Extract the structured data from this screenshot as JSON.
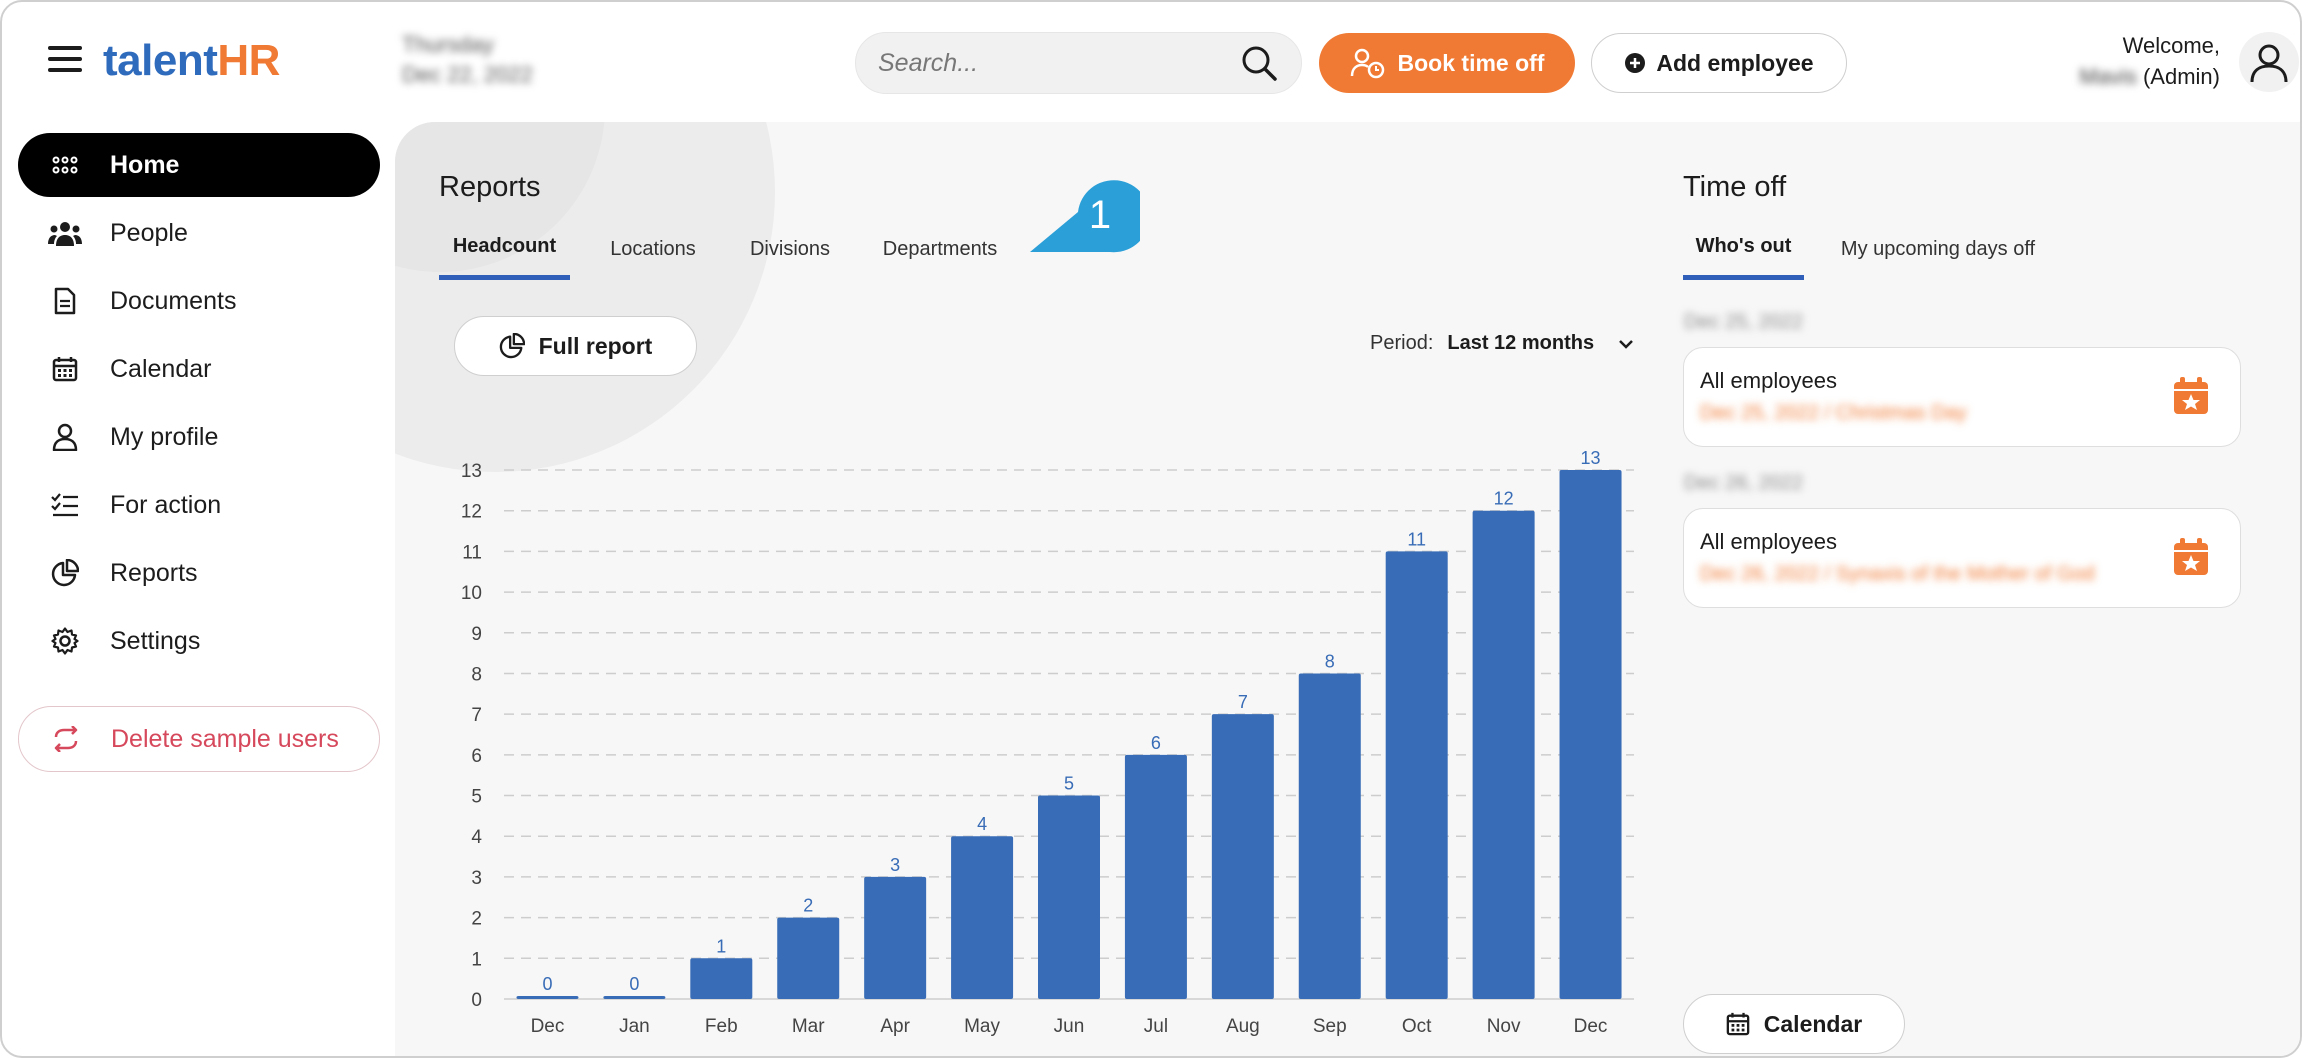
{
  "header": {
    "logo_part1": "talent",
    "logo_part2": "HR",
    "day": "Thursday",
    "date": "Dec 22, 2022",
    "search_placeholder": "Search...",
    "book_time_off": "Book time off",
    "add_employee": "Add employee",
    "welcome": "Welcome,",
    "user_name": "Mavis",
    "user_role": "(Admin)"
  },
  "sidebar": {
    "items": [
      {
        "label": "Home",
        "icon": "grid-icon"
      },
      {
        "label": "People",
        "icon": "people-icon"
      },
      {
        "label": "Documents",
        "icon": "document-icon"
      },
      {
        "label": "Calendar",
        "icon": "calendar-icon"
      },
      {
        "label": "My profile",
        "icon": "user-icon"
      },
      {
        "label": "For action",
        "icon": "checklist-icon"
      },
      {
        "label": "Reports",
        "icon": "pie-chart-icon"
      },
      {
        "label": "Settings",
        "icon": "gear-icon"
      }
    ],
    "delete_sample_users": "Delete sample users"
  },
  "reports": {
    "title": "Reports",
    "tabs": [
      "Headcount",
      "Locations",
      "Divisions",
      "Departments"
    ],
    "active_tab": "Headcount",
    "full_report": "Full report",
    "period_label": "Period:",
    "period_value": "Last 12 months",
    "callout_number": "1"
  },
  "chart_data": {
    "type": "bar",
    "categories": [
      "Dec",
      "Jan",
      "Feb",
      "Mar",
      "Apr",
      "May",
      "Jun",
      "Jul",
      "Aug",
      "Sep",
      "Oct",
      "Nov",
      "Dec"
    ],
    "values": [
      0,
      0,
      1,
      2,
      3,
      4,
      5,
      6,
      7,
      8,
      11,
      12,
      13
    ],
    "y_ticks": [
      0,
      1,
      2,
      3,
      4,
      5,
      6,
      7,
      8,
      9,
      10,
      11,
      12,
      13
    ],
    "ylim": [
      0,
      13
    ],
    "grid": true,
    "data_labels": true,
    "bar_color": "#386cb6"
  },
  "time_off": {
    "title": "Time off",
    "tabs": [
      "Who's out",
      "My upcoming days off"
    ],
    "active_tab": "Who's out",
    "entries": [
      {
        "day": "Dec 25, 2022",
        "who": "All employees",
        "detail": "Dec 25, 2022 / Christmas Day"
      },
      {
        "day": "Dec 26, 2022",
        "who": "All employees",
        "detail": "Dec 26, 2022 / Synaxis of the Mother of God"
      }
    ],
    "calendar_button": "Calendar"
  },
  "colors": {
    "accent_orange": "#f07a34",
    "brand_blue": "#2f6bbd",
    "tab_underline": "#2f5fb8",
    "danger": "#d6485b",
    "callout": "#2a9fd8"
  }
}
